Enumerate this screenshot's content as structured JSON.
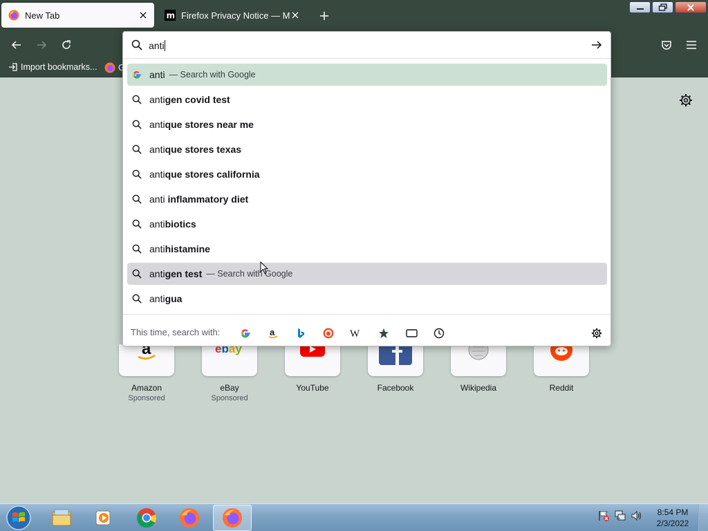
{
  "browser": {
    "tabs": [
      {
        "title": "New Tab",
        "active": true,
        "icon": "firefox-icon"
      },
      {
        "title": "Firefox Privacy Notice — Mozilla",
        "active": false,
        "icon": "mozilla-m-icon"
      }
    ],
    "bookmarks": [
      {
        "label": "Import bookmarks...",
        "icon": "import-icon"
      },
      {
        "label": "G",
        "icon": "firefox-icon"
      }
    ]
  },
  "urlbar": {
    "value": "anti",
    "suggestions": [
      {
        "typed": "anti",
        "completion": "",
        "action": "— Search with Google",
        "icon": "google-icon",
        "state": "selected"
      },
      {
        "typed": "anti",
        "completion": "gen covid test",
        "action": "",
        "icon": "search-icon",
        "state": ""
      },
      {
        "typed": "anti",
        "completion": "que stores near me",
        "action": "",
        "icon": "search-icon",
        "state": ""
      },
      {
        "typed": "anti",
        "completion": "que stores texas",
        "action": "",
        "icon": "search-icon",
        "state": ""
      },
      {
        "typed": "anti",
        "completion": "que stores california",
        "action": "",
        "icon": "search-icon",
        "state": ""
      },
      {
        "typed": "anti ",
        "completion": "inflammatory diet",
        "action": "",
        "icon": "search-icon",
        "state": ""
      },
      {
        "typed": "anti",
        "completion": "biotics",
        "action": "",
        "icon": "search-icon",
        "state": ""
      },
      {
        "typed": "anti",
        "completion": "histamine",
        "action": "",
        "icon": "search-icon",
        "state": ""
      },
      {
        "typed": "anti",
        "completion": "gen test",
        "action": "— Search with Google",
        "icon": "search-icon",
        "state": "hover"
      },
      {
        "typed": "anti",
        "completion": "gua",
        "action": "",
        "icon": "search-icon",
        "state": ""
      }
    ],
    "oneoff_label": "This time, search with:",
    "engines": [
      "google-icon",
      "amazon-icon",
      "bing-icon",
      "duckduckgo-icon",
      "wikipedia-icon",
      "bookmarks-star-icon",
      "tabs-icon",
      "history-clock-icon"
    ]
  },
  "tiles": [
    {
      "name": "Amazon",
      "sub": "Sponsored"
    },
    {
      "name": "eBay",
      "sub": "Sponsored"
    },
    {
      "name": "YouTube",
      "sub": ""
    },
    {
      "name": "Facebook",
      "sub": ""
    },
    {
      "name": "Wikipedia",
      "sub": ""
    },
    {
      "name": "Reddit",
      "sub": ""
    }
  ],
  "taskbar": {
    "apps": [
      "file-explorer-icon",
      "media-player-icon",
      "chrome-icon",
      "firefox-icon",
      "firefox-icon"
    ],
    "clock_time": "8:54 PM",
    "clock_date": "2/3/2022"
  },
  "colors": {
    "chrome": "#37483f",
    "content_bg": "#c9d4ce",
    "selected_row": "#cce1d4",
    "hover_row": "#d7d7db"
  }
}
